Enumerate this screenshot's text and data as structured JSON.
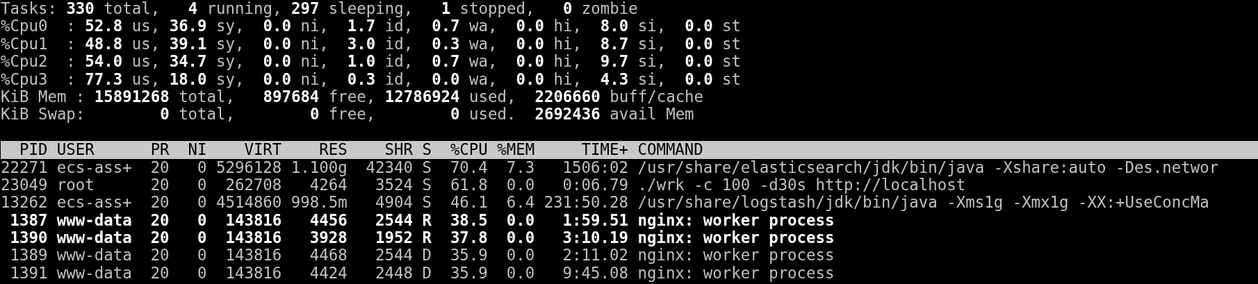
{
  "summary": [
    "Tasks: **330** total,   **4** running, **297** sleeping,   **1** stopped,   **0** zombie",
    "%Cpu0  : **52.8** us, **36.9** sy,  **0.0** ni,  **1.7** id,  **0.7** wa,  **0.0** hi,  **8.0** si,  **0.0** st",
    "%Cpu1  : **48.8** us, **39.1** sy,  **0.0** ni,  **3.0** id,  **0.3** wa,  **0.0** hi,  **8.7** si,  **0.0** st",
    "%Cpu2  : **54.0** us, **34.7** sy,  **0.0** ni,  **1.0** id,  **0.7** wa,  **0.0** hi,  **9.7** si,  **0.0** st",
    "%Cpu3  : **77.3** us, **18.0** sy,  **0.0** ni,  **0.3** id,  **0.0** wa,  **0.0** hi,  **4.3** si,  **0.0** st",
    "KiB Mem : **15891268** total,   **897684** free, **12786924** used,  **2206660** buff/cache",
    "KiB Swap:        **0** total,        **0** free,        **0** used.  **2692436** avail Mem"
  ],
  "table": {
    "columns": [
      "PID",
      "USER",
      "PR",
      "NI",
      "VIRT",
      "RES",
      "SHR",
      "S",
      "%CPU",
      "%MEM",
      "TIME+",
      "COMMAND"
    ],
    "rows": [
      {
        "highlighted": false,
        "cells": [
          "22271",
          "ecs-ass+",
          "20",
          "0",
          "5296128",
          "1.100g",
          "42340",
          "S",
          "70.4",
          "7.3",
          "1506:02",
          "/usr/share/elasticsearch/jdk/bin/java -Xshare:auto -Des.networ"
        ]
      },
      {
        "highlighted": false,
        "cells": [
          "23049",
          "root",
          "20",
          "0",
          "262708",
          "4264",
          "3524",
          "S",
          "61.8",
          "0.0",
          "0:06.79",
          "./wrk -c 100 -d30s http://localhost"
        ]
      },
      {
        "highlighted": false,
        "cells": [
          "13262",
          "ecs-ass+",
          "20",
          "0",
          "4514860",
          "998.5m",
          "4904",
          "S",
          "46.1",
          "6.4",
          "231:50.28",
          "/usr/share/logstash/jdk/bin/java -Xms1g -Xmx1g -XX:+UseConcMa"
        ]
      },
      {
        "highlighted": true,
        "cells": [
          "1387",
          "www-data",
          "20",
          "0",
          "143816",
          "4456",
          "2544",
          "R",
          "38.5",
          "0.0",
          "1:59.51",
          "nginx: worker process"
        ]
      },
      {
        "highlighted": true,
        "cells": [
          "1390",
          "www-data",
          "20",
          "0",
          "143816",
          "3928",
          "1952",
          "R",
          "37.8",
          "0.0",
          "3:10.19",
          "nginx: worker process"
        ]
      },
      {
        "highlighted": false,
        "cells": [
          "1389",
          "www-data",
          "20",
          "0",
          "143816",
          "4468",
          "2544",
          "D",
          "35.9",
          "0.0",
          "2:11.02",
          "nginx: worker process"
        ]
      },
      {
        "highlighted": false,
        "cells": [
          "1391",
          "www-data",
          "20",
          "0",
          "143816",
          "4424",
          "2448",
          "D",
          "35.9",
          "0.0",
          "9:45.08",
          "nginx: worker process"
        ]
      }
    ]
  }
}
